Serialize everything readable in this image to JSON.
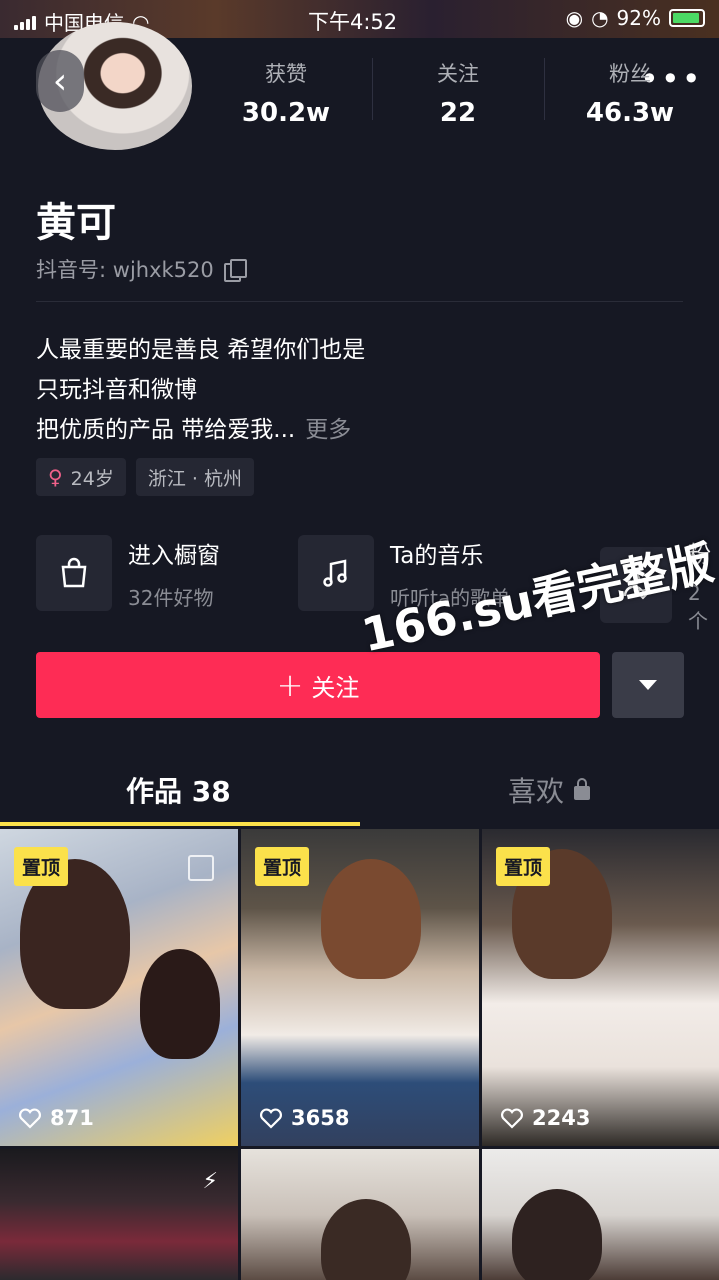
{
  "status_bar": {
    "carrier": "中国电信",
    "time": "下午4:52",
    "battery": "92%"
  },
  "profile": {
    "name": "黄可",
    "douyin_id_label": "抖音号: ",
    "douyin_id": "wjhxk520",
    "stats": [
      {
        "label": "获赞",
        "value": "30.2w"
      },
      {
        "label": "关注",
        "value": "22"
      },
      {
        "label": "粉丝",
        "value": "46.3w"
      }
    ],
    "bio_lines": [
      "人最重要的是善良 希望你们也是",
      "只玩抖音和微博",
      "把优质的产品 带给爱我..."
    ],
    "bio_more": "更多",
    "tags": [
      {
        "icon": "female-icon",
        "text": "24岁"
      },
      {
        "text": "浙江 · 杭州"
      }
    ]
  },
  "entries": [
    {
      "icon": "shopping-bag-icon",
      "title": "进入橱窗",
      "sub": "32件好物"
    },
    {
      "icon": "music-note-icon",
      "title": "Ta的音乐",
      "sub": "听听ta的歌单"
    },
    {
      "icon": "fans-group-icon",
      "title": "粉",
      "sub": "2个"
    }
  ],
  "actions": {
    "follow_label": "关注"
  },
  "watermark": "166.su看完整版",
  "tabs": {
    "works": "作品 38",
    "likes": "喜欢"
  },
  "videos": [
    {
      "pinned": "置顶",
      "likes": "871"
    },
    {
      "pinned": "置顶",
      "likes": "3658"
    },
    {
      "pinned": "置顶",
      "likes": "2243"
    },
    {},
    {},
    {}
  ],
  "colors": {
    "background": "#161823",
    "follow": "#fe2c55",
    "accent": "#fbe14b"
  }
}
